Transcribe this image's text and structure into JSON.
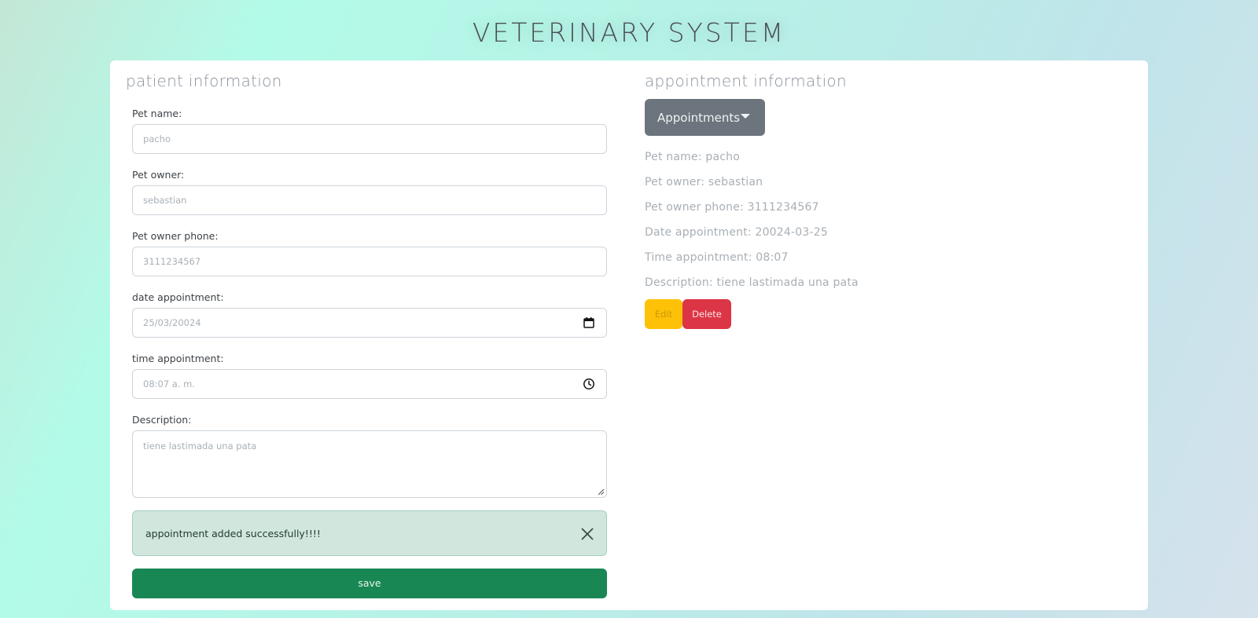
{
  "app": {
    "title": "VETERINARY SYSTEM"
  },
  "patient": {
    "title": "patient information",
    "fields": {
      "pet_name": {
        "label": "Pet name:",
        "value": "pacho"
      },
      "pet_owner": {
        "label": "Pet owner:",
        "value": "sebastian"
      },
      "owner_phone": {
        "label": "Pet owner phone:",
        "value": "3111234567"
      },
      "date": {
        "label": "date appointment:",
        "value": "25/03/20024",
        "icon": "calendar-icon"
      },
      "time": {
        "label": "time appointment:",
        "value": "08:07 a. m.",
        "icon": "clock-icon"
      },
      "description": {
        "label": "Description:",
        "value": "tiene lastimada una pata"
      }
    },
    "alert": {
      "text": "appointment added successfully!!!!",
      "color": "#d1e7dd"
    },
    "save_label": "save"
  },
  "appointment": {
    "title": "appointment information",
    "dropdown_label": "Appointments",
    "details": {
      "pet_name": "Pet name: pacho",
      "pet_owner": "Pet owner: sebastian",
      "owner_phone": "Pet owner phone: 3111234567",
      "date": "Date appointment: 20024-03-25",
      "time": "Time appointment: 08:07",
      "description": "Description: tiene lastimada una pata"
    },
    "edit_label": "Edit",
    "delete_label": "Delete"
  },
  "colors": {
    "save": "#198754",
    "dropdown": "#6c757d",
    "edit": "#ffc107",
    "delete": "#dc3545"
  }
}
